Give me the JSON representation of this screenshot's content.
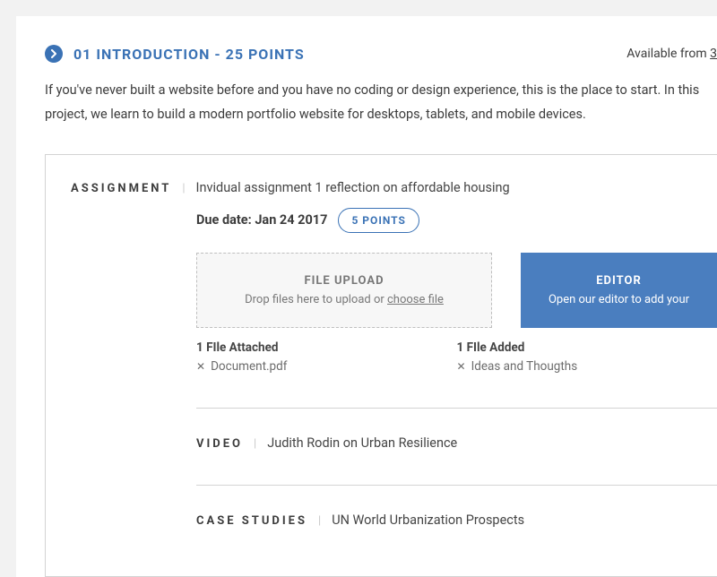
{
  "header": {
    "title": "01 INTRODUCTION - 25 POINTS",
    "available_prefix": "Available from ",
    "available_date": "3"
  },
  "intro": "If you've never built a website before and you have no coding or design experience, this is the place to start. In this project, we learn to build a modern portfolio website for desktops, tablets, and mobile devices.",
  "assignment": {
    "label": "ASSIGNMENT",
    "title": "Invidual assignment 1 reflection on affordable housing",
    "due_prefix": "Due date: ",
    "due_date": "Jan 24 2017",
    "points": "5 POINTS"
  },
  "upload": {
    "title": "FILE UPLOAD",
    "sub_prefix": "Drop files here to upload or ",
    "choose": "choose file"
  },
  "editor": {
    "title": "EDITOR",
    "sub": "Open our editor to add your"
  },
  "attached": {
    "left_head": "1 FIle Attached",
    "left_item": "Document.pdf",
    "right_head": "1 FIle Added",
    "right_item": "Ideas and Thougths"
  },
  "video": {
    "label": "VIDEO",
    "title": "Judith Rodin on Urban Resilience"
  },
  "case": {
    "label": "CASE STUDIES",
    "title": "UN World Urbanization Prospects"
  },
  "sep": "|"
}
